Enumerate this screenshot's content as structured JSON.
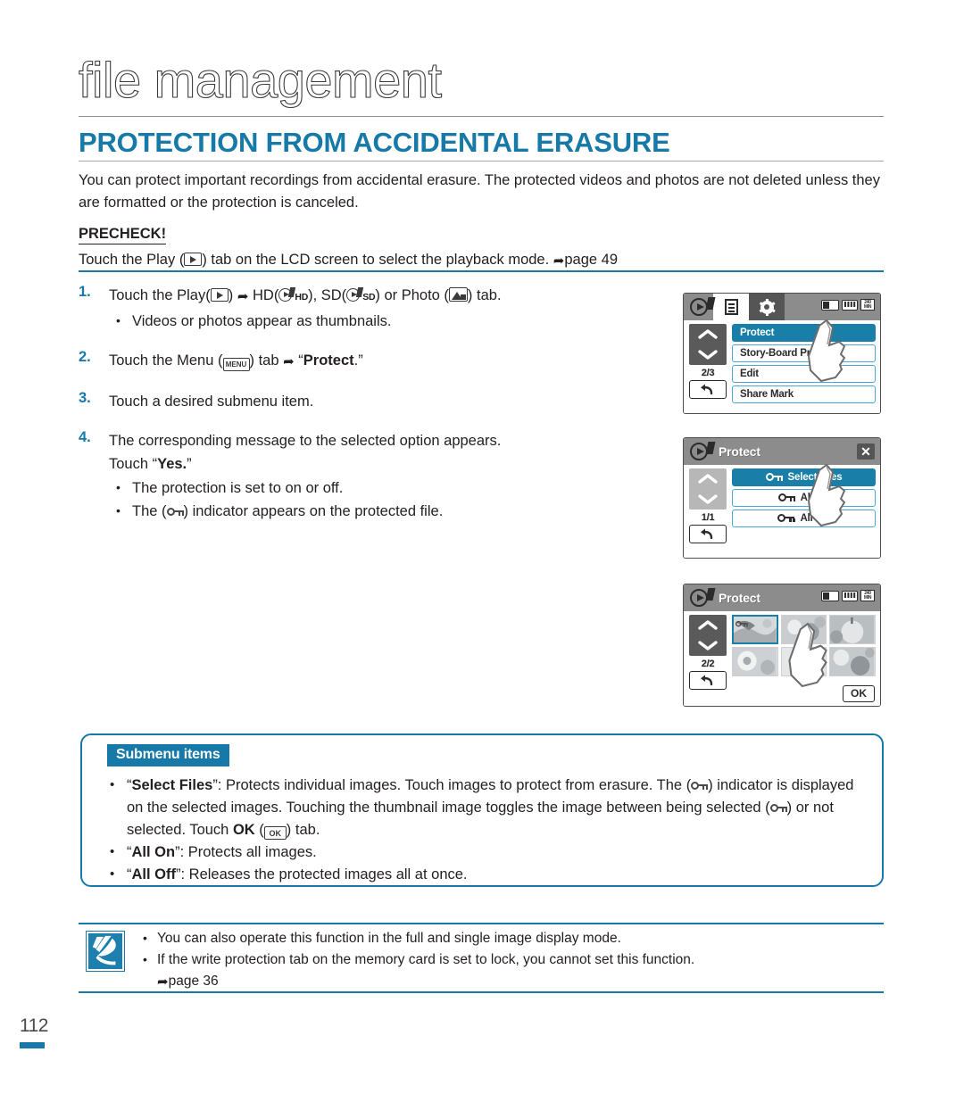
{
  "colors": {
    "accent": "#1679a8",
    "lcd_selected": "#1a7fa8",
    "lcd_border": "#4aa8d8",
    "text": "#231f20"
  },
  "header": {
    "chapter_title": "file management",
    "section_title": "PROTECTION FROM ACCIDENTAL ERASURE",
    "intro": "You can protect important recordings from accidental erasure. The protected videos and photos are not deleted unless they are formatted or the protection is canceled."
  },
  "precheck": {
    "label": "PRECHECK!",
    "text_before": "Touch the Play (",
    "text_after": ") tab on the LCD screen to select the playback mode. ",
    "page_ref": "page 49"
  },
  "steps": [
    {
      "num": "1.",
      "text_a": "Touch the Play(",
      "text_b": ") ",
      "text_c": " HD(",
      "hd_label": "HD",
      "text_d": "), SD(",
      "sd_label": "SD",
      "text_e": ") or Photo (",
      "text_f": ") tab.",
      "bullets": [
        "Videos or photos appear as thumbnails."
      ]
    },
    {
      "num": "2.",
      "text_a": "Touch the Menu (",
      "menu_label": "MENU",
      "text_b": ") tab ",
      "text_c": " “",
      "bold": "Protect",
      "text_d": ".”",
      "bullets": []
    },
    {
      "num": "3.",
      "text_a": "Touch a desired submenu item.",
      "bullets": []
    },
    {
      "num": "4.",
      "text_a": "The corresponding message to the selected option appears.",
      "text_b": "Touch “",
      "bold": "Yes.",
      "text_c": "”",
      "bullets": [
        "The protection is set to on or off.",
        "The ( ) indicator appears on the protected file."
      ],
      "bullet_1_a": "The protection is set to on or off.",
      "bullet_2_a": "The (",
      "bullet_2_b": ") indicator appears on the protected file."
    }
  ],
  "lcd_screens": [
    {
      "name": "menu-screen",
      "tabs": [
        "play-film-icon",
        "document-icon",
        "gear-icon"
      ],
      "active_tab": "document-icon",
      "battery": true,
      "time_chip": "240 MIN",
      "pager": "2/3",
      "items": [
        {
          "label": "Protect",
          "selected": true
        },
        {
          "label": "Story-Board Print",
          "selected": false
        },
        {
          "label": "Edit",
          "selected": false
        },
        {
          "label": "Share Mark",
          "selected": false
        }
      ]
    },
    {
      "name": "protect-options-screen",
      "title": "Protect",
      "close": "✕",
      "pager": "1/1",
      "items": [
        {
          "label": "Select Files",
          "selected": true
        },
        {
          "label": "All On",
          "selected": false
        },
        {
          "label": "All Off",
          "selected": false
        }
      ]
    },
    {
      "name": "protect-thumbnails-screen",
      "title": "Protect",
      "time_chip": "240 MIN",
      "pager": "2/2",
      "ok_label": "OK",
      "thumbs": [
        {
          "selected": true,
          "protected": true
        },
        {
          "selected": false,
          "protected": false
        },
        {
          "selected": false,
          "protected": false
        },
        {
          "selected": false,
          "protected": false
        },
        {
          "selected": false,
          "protected": false
        },
        {
          "selected": false,
          "protected": false
        }
      ]
    }
  ],
  "submenu": {
    "badge": "Submenu items",
    "items": [
      {
        "a": "“",
        "bold": "Select Files",
        "b": "”: Protects individual images. Touch images to protect from erasure. The (",
        "c": ") indicator is displayed on the selected images. Touching the thumbnail image toggles the image between being selected (",
        "d": ") or not selected. Touch ",
        "bold2": "OK",
        "e": " (",
        "f": ") tab."
      },
      {
        "a": "“",
        "bold": "All On",
        "b": "”: Protects all images."
      },
      {
        "a": "“",
        "bold": "All Off",
        "b": "”: Releases the protected images all at once."
      }
    ]
  },
  "note": {
    "items": [
      "You can also operate this function in the full and single image display mode.",
      "If the write protection tab on the memory card is set to lock, you cannot set this function."
    ],
    "page_ref": "page 36"
  },
  "footer": {
    "page_number": "112"
  }
}
